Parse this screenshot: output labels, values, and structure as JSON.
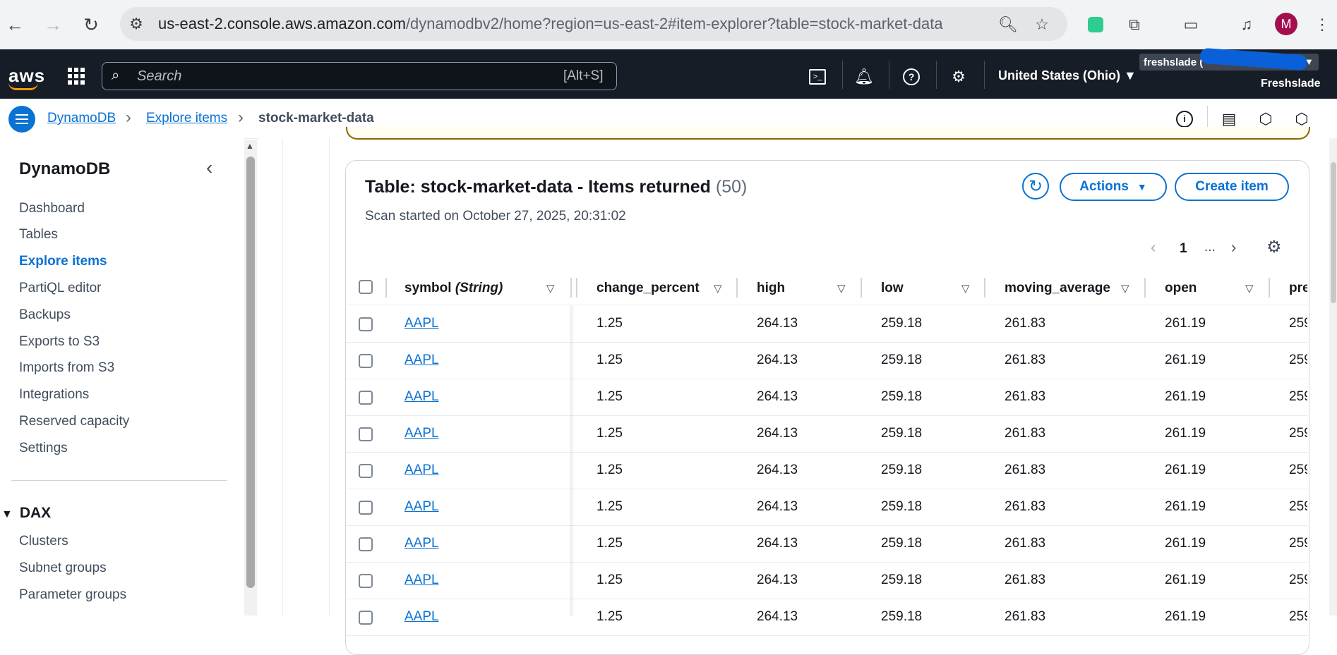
{
  "browser": {
    "url_host": "us-east-2.console.aws.amazon.com",
    "url_path": "/dynamodbv2/home?region=us-east-2#item-explorer?table=stock-market-data"
  },
  "topbar": {
    "search_placeholder": "Search",
    "search_shortcut": "[Alt+S]",
    "region": "United States (Ohio)",
    "account_box": "freshslade (",
    "account_name": "Freshslade",
    "avatar_letter": "M"
  },
  "breadcrumb": {
    "items": [
      "DynamoDB",
      "Explore items",
      "stock-market-data"
    ]
  },
  "sidebar": {
    "title": "DynamoDB",
    "items": [
      "Dashboard",
      "Tables",
      "Explore items",
      "PartiQL editor",
      "Backups",
      "Exports to S3",
      "Imports from S3",
      "Integrations",
      "Reserved capacity",
      "Settings"
    ],
    "section": "DAX",
    "section_items": [
      "Clusters",
      "Subnet groups",
      "Parameter groups"
    ]
  },
  "table_panel": {
    "title": "Table: stock-market-data - Items returned",
    "count": "(50)",
    "subtitle": "Scan started on October 27, 2025, 20:31:02",
    "actions_label": "Actions",
    "create_label": "Create item",
    "page_current": "1",
    "page_more": "..."
  },
  "columns": [
    "symbol (String)",
    "change_percent",
    "high",
    "low",
    "moving_average",
    "open",
    "pre"
  ],
  "rows": [
    [
      "AAPL",
      "1.25",
      "264.13",
      "259.18",
      "261.83",
      "261.19",
      "259"
    ],
    [
      "AAPL",
      "1.25",
      "264.13",
      "259.18",
      "261.83",
      "261.19",
      "259"
    ],
    [
      "AAPL",
      "1.25",
      "264.13",
      "259.18",
      "261.83",
      "261.19",
      "259"
    ],
    [
      "AAPL",
      "1.25",
      "264.13",
      "259.18",
      "261.83",
      "261.19",
      "259"
    ],
    [
      "AAPL",
      "1.25",
      "264.13",
      "259.18",
      "261.83",
      "261.19",
      "259"
    ],
    [
      "AAPL",
      "1.25",
      "264.13",
      "259.18",
      "261.83",
      "261.19",
      "259"
    ],
    [
      "AAPL",
      "1.25",
      "264.13",
      "259.18",
      "261.83",
      "261.19",
      "259"
    ],
    [
      "AAPL",
      "1.25",
      "264.13",
      "259.18",
      "261.83",
      "261.19",
      "259"
    ],
    [
      "AAPL",
      "1.25",
      "264.13",
      "259.18",
      "261.83",
      "261.19",
      "259"
    ]
  ],
  "colors": {
    "aws_nav": "#161d26",
    "link_blue": "#0972d3",
    "aws_orange": "#ff9900"
  }
}
